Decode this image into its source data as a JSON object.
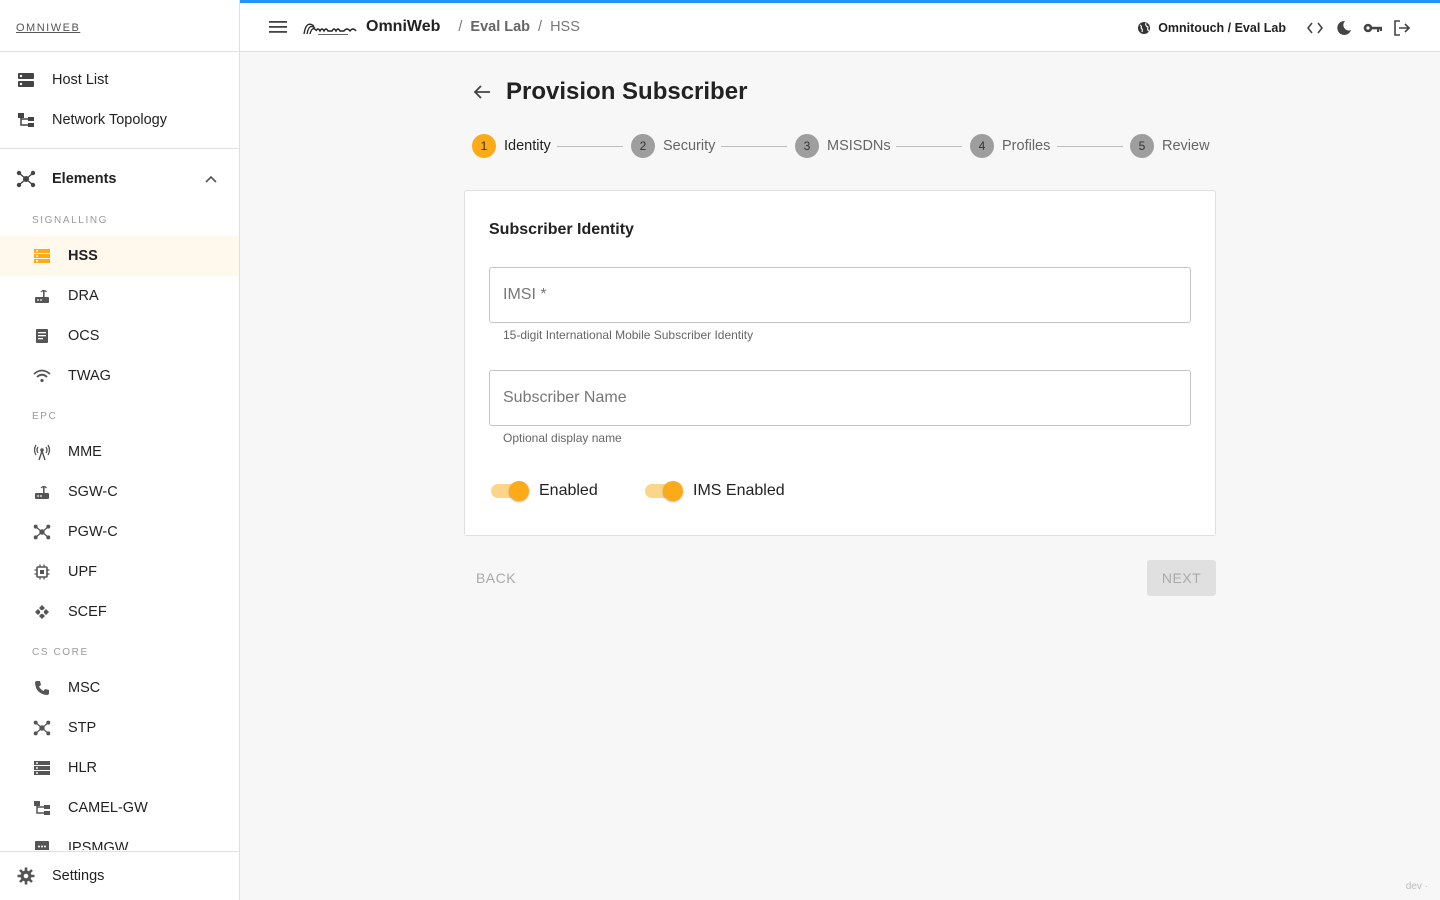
{
  "brand": {
    "label": "OMNIWEB"
  },
  "nav": {
    "host_list": "Host List",
    "network_topology": "Network Topology",
    "elements_group": "Elements",
    "settings": "Settings"
  },
  "sections": {
    "signalling": "SIGNALLING",
    "epc": "EPC",
    "cs_core": "CS CORE"
  },
  "elements": {
    "hss": "HSS",
    "dra": "DRA",
    "ocs": "OCS",
    "twag": "TWAG",
    "mme": "MME",
    "sgwc": "SGW-C",
    "pgwc": "PGW-C",
    "upf": "UPF",
    "scef": "SCEF",
    "msc": "MSC",
    "stp": "STP",
    "hlr": "HLR",
    "camelgw": "CAMEL-GW",
    "ipsmgw": "IPSMGW"
  },
  "topbar": {
    "app_name": "OmniWeb",
    "breadcrumb": [
      "Eval Lab",
      "/",
      "HSS"
    ],
    "breadcrumb_sep": "/",
    "tenant": "Omnitouch / Eval Lab"
  },
  "page": {
    "title": "Provision Subscriber"
  },
  "steps": [
    {
      "num": "1",
      "label": "Identity"
    },
    {
      "num": "2",
      "label": "Security"
    },
    {
      "num": "3",
      "label": "MSISDNs"
    },
    {
      "num": "4",
      "label": "Profiles"
    },
    {
      "num": "5",
      "label": "Review"
    }
  ],
  "active_step": 1,
  "form": {
    "card_title": "Subscriber Identity",
    "imsi_placeholder": "IMSI *",
    "imsi_value": "",
    "imsi_helper": "15-digit International Mobile Subscriber Identity",
    "name_placeholder": "Subscriber Name",
    "name_value": "",
    "name_helper": "Optional display name",
    "enabled_label": "Enabled",
    "enabled_on": true,
    "ims_label": "IMS Enabled",
    "ims_on": true
  },
  "actions": {
    "back": "BACK",
    "next": "NEXT"
  },
  "env_label": "dev ·",
  "colors": {
    "accent": "#fbab18",
    "topbar_border": "#2196f3",
    "active_row_bg": "#fff8ec"
  }
}
